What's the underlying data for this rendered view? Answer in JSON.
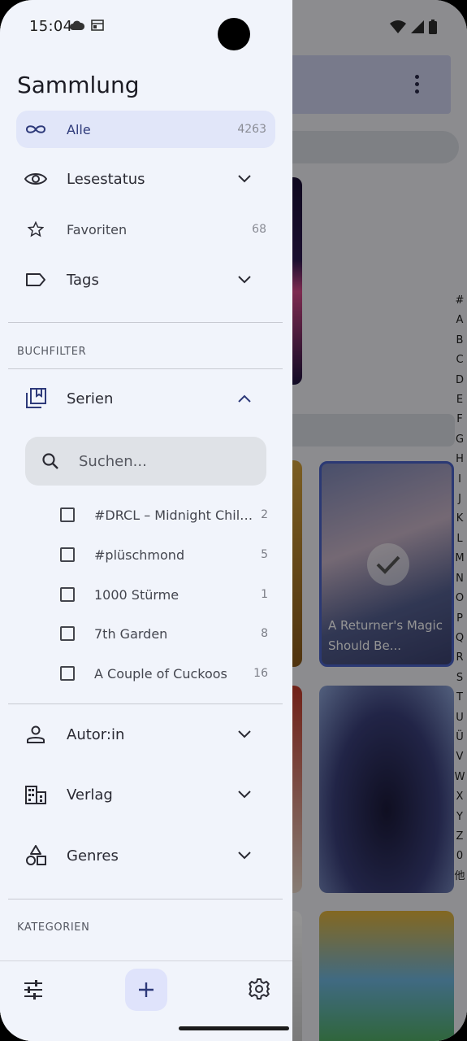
{
  "status_bar": {
    "time": "15:04"
  },
  "drawer": {
    "title": "Sammlung",
    "items": [
      {
        "label": "Alle",
        "count": "4263",
        "icon": "infinity-icon",
        "active": true
      },
      {
        "label": "Lesestatus",
        "icon": "eye-icon",
        "expandable": true
      },
      {
        "label": "Favoriten",
        "count": "68",
        "icon": "star-icon"
      },
      {
        "label": "Tags",
        "icon": "label-icon",
        "expandable": true
      }
    ],
    "book_filter": {
      "heading": "BUCHFILTER",
      "series": {
        "label": "Serien",
        "expanded": true,
        "search_placeholder": "Suchen...",
        "rows": [
          {
            "label": "#DRCL – Midnight Children",
            "count": "2"
          },
          {
            "label": "#plüschmond",
            "count": "5"
          },
          {
            "label": "1000 Stürme",
            "count": "1"
          },
          {
            "label": "7th Garden",
            "count": "8"
          },
          {
            "label": "A Couple of Cuckoos",
            "count": "16"
          }
        ]
      },
      "author": "Autor:in",
      "publisher": "Verlag",
      "genres": "Genres"
    },
    "categories_heading": "KATEGORIEN"
  },
  "background": {
    "cover_title": "A Returner's Magic Should Be...",
    "alphabet": [
      "#",
      "A",
      "B",
      "C",
      "D",
      "E",
      "F",
      "G",
      "H",
      "I",
      "J",
      "K",
      "L",
      "M",
      "N",
      "O",
      "P",
      "Q",
      "R",
      "S",
      "T",
      "U",
      "Ü",
      "V",
      "W",
      "X",
      "Y",
      "Z",
      "0",
      "他"
    ]
  },
  "colors": {
    "accent": "#2e3a7a",
    "active_bg": "#e1e6f9",
    "drawer_bg": "#f1f4fb"
  }
}
